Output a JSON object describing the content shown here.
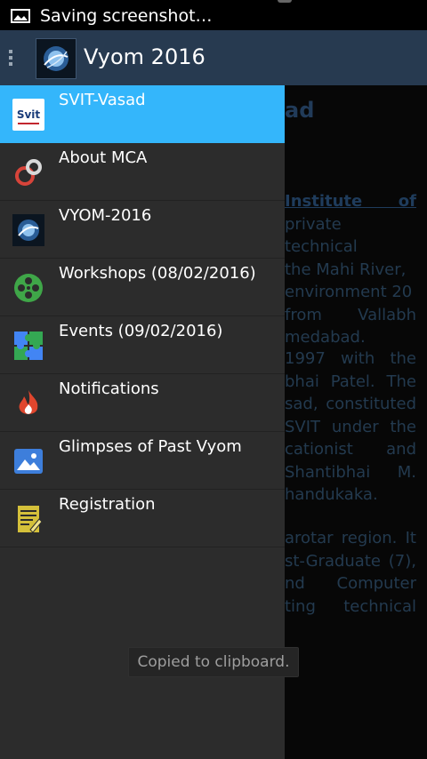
{
  "status_bar": {
    "text": "Saving screenshot…",
    "icon": "image-icon"
  },
  "action_bar": {
    "title": "Vyom 2016",
    "menu_icon": "drawer-menu-icon",
    "logo_icon": "vyom-logo-icon"
  },
  "background_content": {
    "heading": "ad",
    "paragraphs": [
      [
        "Institute of",
        "private technical",
        "the Mahi River,",
        "environment 20",
        "from Vallabh",
        "medabad."
      ],
      [
        "1997 with the",
        "bhai Patel. The",
        "sad, constituted",
        "SVIT under the",
        "cationist and",
        "Shantibhai M.",
        "handukaka."
      ],
      [
        "arotar region. It",
        "st-Graduate (7),",
        "nd Computer",
        "ting technical"
      ]
    ]
  },
  "drawer": {
    "items": [
      {
        "label": "SVIT-Vasad",
        "icon": "svit-logo-icon",
        "active": true
      },
      {
        "label": "About MCA",
        "icon": "mca-icon"
      },
      {
        "label": "VYOM-2016",
        "icon": "vyom-logo-icon"
      },
      {
        "label": "Workshops (08/02/2016)",
        "icon": "film-reel-icon"
      },
      {
        "label": "Events (09/02/2016)",
        "icon": "puzzle-icon"
      },
      {
        "label": "Notifications",
        "icon": "flame-icon"
      },
      {
        "label": "Glimpses of Past Vyom",
        "icon": "picture-icon"
      },
      {
        "label": "Registration",
        "icon": "document-icon"
      }
    ]
  },
  "toast": {
    "text": "Copied to clipboard."
  },
  "colors": {
    "drawer_bg": "#2c2c2c",
    "active_item": "#34b6fb",
    "action_bar": "#273a50"
  }
}
